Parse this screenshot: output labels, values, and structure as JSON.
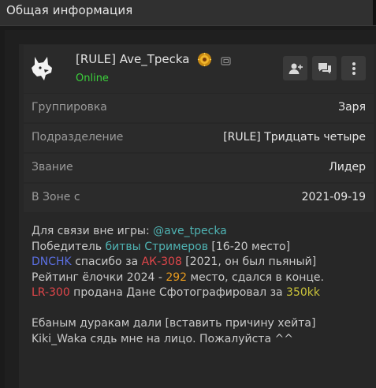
{
  "header": {
    "title": "Общая информация"
  },
  "profile": {
    "name": "[RULE] Ave_Трecka",
    "status": "Online",
    "avatar_icon": "wolf-icon",
    "badge_icon": "gold-emblem-icon",
    "actions": [
      "add-friend-icon",
      "chat-icon",
      "more-vertical-icon"
    ]
  },
  "rows": [
    {
      "label": "Группировка",
      "value": "Заря"
    },
    {
      "label": "Подразделение",
      "value": "[RULE] Тридцать четыре"
    },
    {
      "label": "Звание",
      "value": "Лидер"
    },
    {
      "label": "В Зоне с",
      "value": "2021-09-19"
    }
  ],
  "bio": {
    "l1_a": "Для связи вне игры: ",
    "l1_b": "@ave_tpecka",
    "l2_a": "Победитель ",
    "l2_b": "битвы Стримеров",
    "l2_c": " [16-20 место]",
    "l3_a": "DNCHK",
    "l3_b": " спасибо за ",
    "l3_c": "АК-308",
    "l3_d": " [2021, он был пьяный]",
    "l4_a": "Рейтинг ёлочки 2024 - ",
    "l4_b": "292",
    "l4_c": " место, сдался в конце.",
    "l5_a": "LR-300",
    "l5_b": " продана Дане Сфотографировал за ",
    "l5_c": "350kk",
    "l7": "Ебаным дуракам дали [вставить причину хейта]",
    "l8": "Kiki_Waka сядь мне на лицо. Пожалуйста ^^"
  },
  "colors": {
    "online": "#3bd13b",
    "link_teal": "#4fb3b3",
    "blue": "#5a6ee0",
    "red": "#e0464a",
    "orange": "#e79a1e",
    "yellow": "#c9c23a"
  }
}
